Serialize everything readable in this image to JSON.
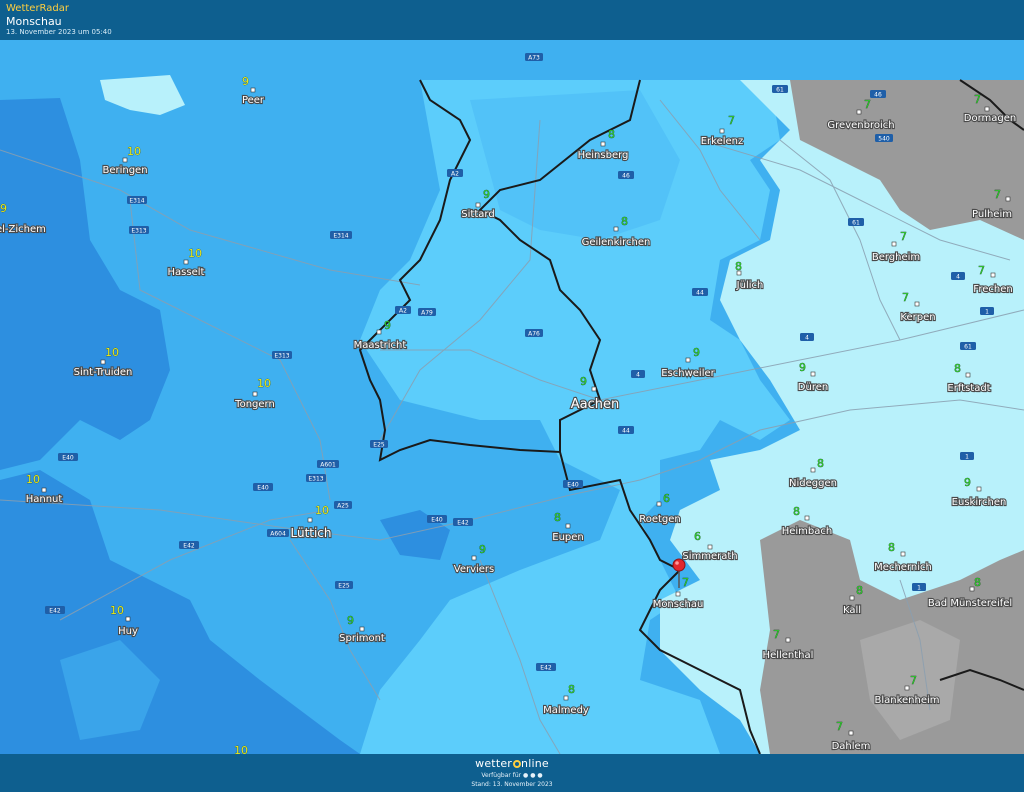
{
  "header": {
    "brand": "WetterRadar",
    "location": "Monschau",
    "timestamp": "13. November 2023 um 05:40"
  },
  "footer": {
    "logo_left": "wetter",
    "logo_right": "nline",
    "available": "Verfügbar für",
    "stand": "Stand: 13. November 2023"
  },
  "colors": {
    "precip_dark": "#2d8fe0",
    "precip_mid": "#3fb0f0",
    "precip_light": "#5ccdfb",
    "clear": "#b8f1fb",
    "terrain": "#9a9a9a",
    "temp_yellow": "#e8e820",
    "temp_green": "#2ec82e",
    "marker": "#e0282e"
  },
  "cities": [
    {
      "name": "Peer",
      "temp": "9"
    },
    {
      "name": "Beringen",
      "temp": "10"
    },
    {
      "name": "el-Zichem",
      "temp": "9"
    },
    {
      "name": "Hasselt",
      "temp": "10"
    },
    {
      "name": "Sint-Truiden",
      "temp": "10"
    },
    {
      "name": "Tongern",
      "temp": "10"
    },
    {
      "name": "Hannut",
      "temp": "10"
    },
    {
      "name": "Lüttich",
      "temp": "10"
    },
    {
      "name": "Huy",
      "temp": "10"
    },
    {
      "name": "Sprimont",
      "temp": "9"
    },
    {
      "name": "Verviers",
      "temp": "9"
    },
    {
      "name": "Eupen",
      "temp": "8"
    },
    {
      "name": "Malmedy",
      "temp": "8"
    },
    {
      "name": "Maastricht",
      "temp": "9"
    },
    {
      "name": "Sittard",
      "temp": "9"
    },
    {
      "name": "Heinsberg",
      "temp": "8"
    },
    {
      "name": "Erkelenz",
      "temp": "7"
    },
    {
      "name": "Geilenkirchen",
      "temp": "8"
    },
    {
      "name": "Aachen",
      "temp": "9"
    },
    {
      "name": "Eschweiler",
      "temp": "9"
    },
    {
      "name": "Jülich",
      "temp": "8"
    },
    {
      "name": "Düren",
      "temp": "9"
    },
    {
      "name": "Roetgen",
      "temp": "6"
    },
    {
      "name": "Simmerath",
      "temp": "6"
    },
    {
      "name": "Monschau",
      "temp": "7"
    },
    {
      "name": "Nideggen",
      "temp": "8"
    },
    {
      "name": "Heimbach",
      "temp": "8"
    },
    {
      "name": "Hellenthal",
      "temp": "7"
    },
    {
      "name": "Kall",
      "temp": "8"
    },
    {
      "name": "Dahlem",
      "temp": "7"
    },
    {
      "name": "Blankenheim",
      "temp": "7"
    },
    {
      "name": "Mechernich",
      "temp": "8"
    },
    {
      "name": "Bad Münstereifel",
      "temp": "8"
    },
    {
      "name": "Euskirchen",
      "temp": "9"
    },
    {
      "name": "Erftstadt",
      "temp": "8"
    },
    {
      "name": "Kerpen",
      "temp": "7"
    },
    {
      "name": "Frechen",
      "temp": "7"
    },
    {
      "name": "Bergheim",
      "temp": "7"
    },
    {
      "name": "Pulheim",
      "temp": "7"
    },
    {
      "name": "Grevenbroich",
      "temp": "7"
    },
    {
      "name": "Dormagen",
      "temp": "7"
    },
    {
      "name": "",
      "temp": "10"
    }
  ],
  "roads": [
    "A73",
    "A2",
    "A2",
    "A79",
    "A76",
    "E314",
    "E313",
    "E314",
    "E313",
    "E25",
    "A601",
    "E313",
    "E40",
    "E40",
    "A25",
    "A604",
    "E42",
    "E42",
    "E40",
    "E42",
    "E40",
    "E25",
    "E42",
    "46",
    "44",
    "4",
    "44",
    "61",
    "46",
    "540",
    "61",
    "4",
    "1",
    "61",
    "1",
    "1",
    "4"
  ]
}
